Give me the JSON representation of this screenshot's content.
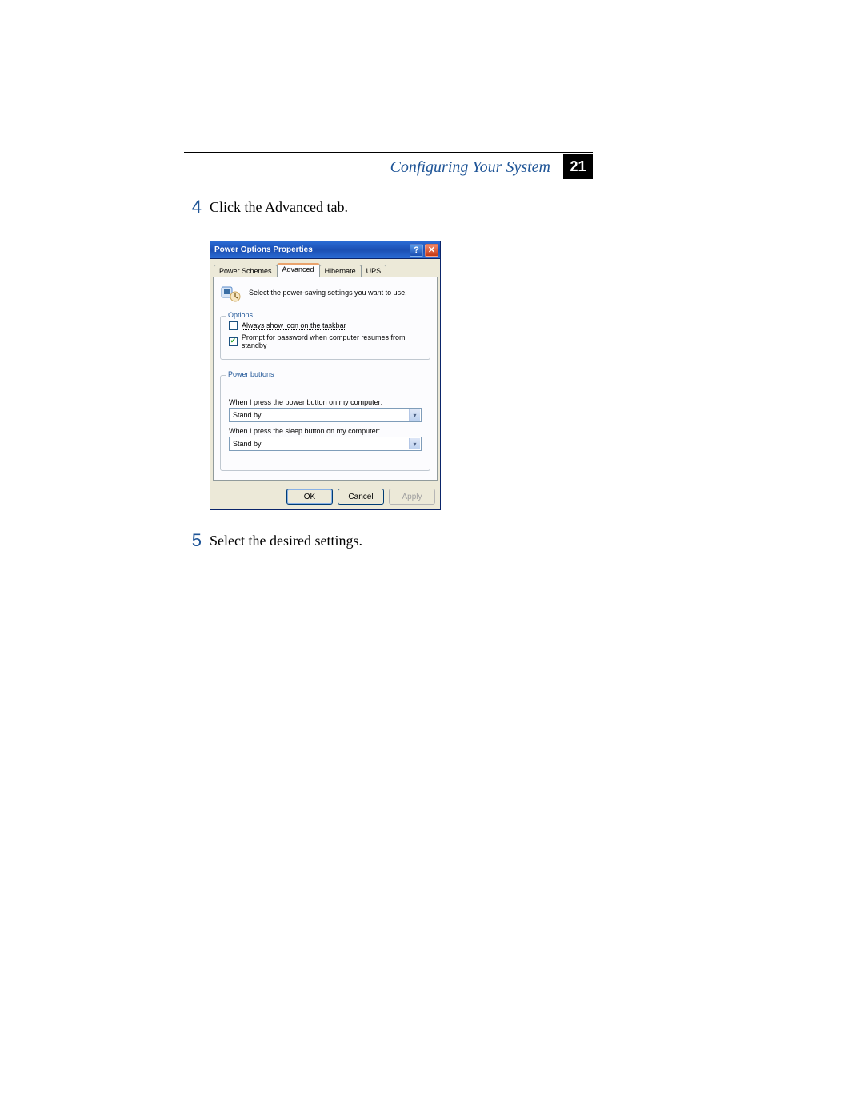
{
  "header": {
    "title": "Configuring Your System",
    "page": "21"
  },
  "steps": {
    "s4_num": "4",
    "s4_text": "Click the Advanced tab.",
    "s5_num": "5",
    "s5_text": "Select the desired settings."
  },
  "dialog": {
    "title": "Power Options Properties",
    "tabs": {
      "schemes": "Power Schemes",
      "advanced": "Advanced",
      "hibernate": "Hibernate",
      "ups": "UPS"
    },
    "intro": "Select the power-saving settings you want to use.",
    "options": {
      "legend": "Options",
      "taskbar": "Always show icon on the taskbar",
      "password": "Prompt for password when computer resumes from standby"
    },
    "power_buttons": {
      "legend": "Power buttons",
      "power_label": "When I press the power button on my computer:",
      "power_value": "Stand by",
      "sleep_label": "When I press the sleep button on my computer:",
      "sleep_value": "Stand by"
    },
    "buttons": {
      "ok": "OK",
      "cancel": "Cancel",
      "apply": "Apply"
    }
  }
}
